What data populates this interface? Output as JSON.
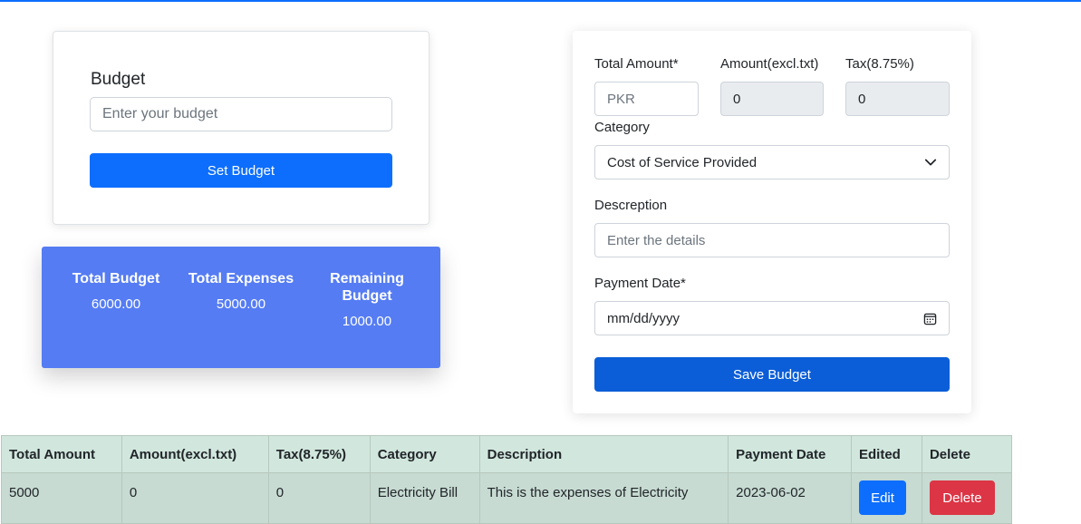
{
  "budget_form": {
    "title": "Budget",
    "input_placeholder": "Enter your budget",
    "button_label": "Set Budget"
  },
  "summary": {
    "total_budget_label": "Total Budget",
    "total_budget_value": "6000.00",
    "total_expenses_label": "Total Expenses",
    "total_expenses_value": "5000.00",
    "remaining_label": "Remaining Budget",
    "remaining_value": "1000.00"
  },
  "expense_form": {
    "total_amount_label": "Total Amount*",
    "total_amount_placeholder": "PKR",
    "amount_excl_label": "Amount(excl.txt)",
    "amount_excl_value": "0",
    "tax_label": "Tax(8.75%)",
    "tax_value": "0",
    "category_label": "Category",
    "category_selected": "Cost of Service Provided",
    "description_label": "Descreption",
    "description_placeholder": "Enter the details",
    "payment_date_label": "Payment Date*",
    "payment_date_placeholder": "mm/dd/yyyy",
    "save_button_label": "Save Budget"
  },
  "table": {
    "headers": [
      "Total Amount",
      "Amount(excl.txt)",
      "Tax(8.75%)",
      "Category",
      "Description",
      "Payment Date",
      "Edited",
      "Delete"
    ],
    "rows": [
      {
        "total_amount": "5000",
        "amount_excl": "0",
        "tax": "0",
        "category": "Electricity Bill",
        "description": "This is the expenses of Electricity",
        "payment_date": "2023-06-02",
        "edit_label": "Edit",
        "delete_label": "Delete"
      }
    ]
  },
  "colors": {
    "primary": "#0d6efd",
    "summary_bg": "#557cf3",
    "danger": "#dc3545",
    "table_header_bg": "#d1e7dd"
  },
  "icons": {
    "payment_date": "calendar-icon",
    "category": "chevron-down-icon"
  }
}
